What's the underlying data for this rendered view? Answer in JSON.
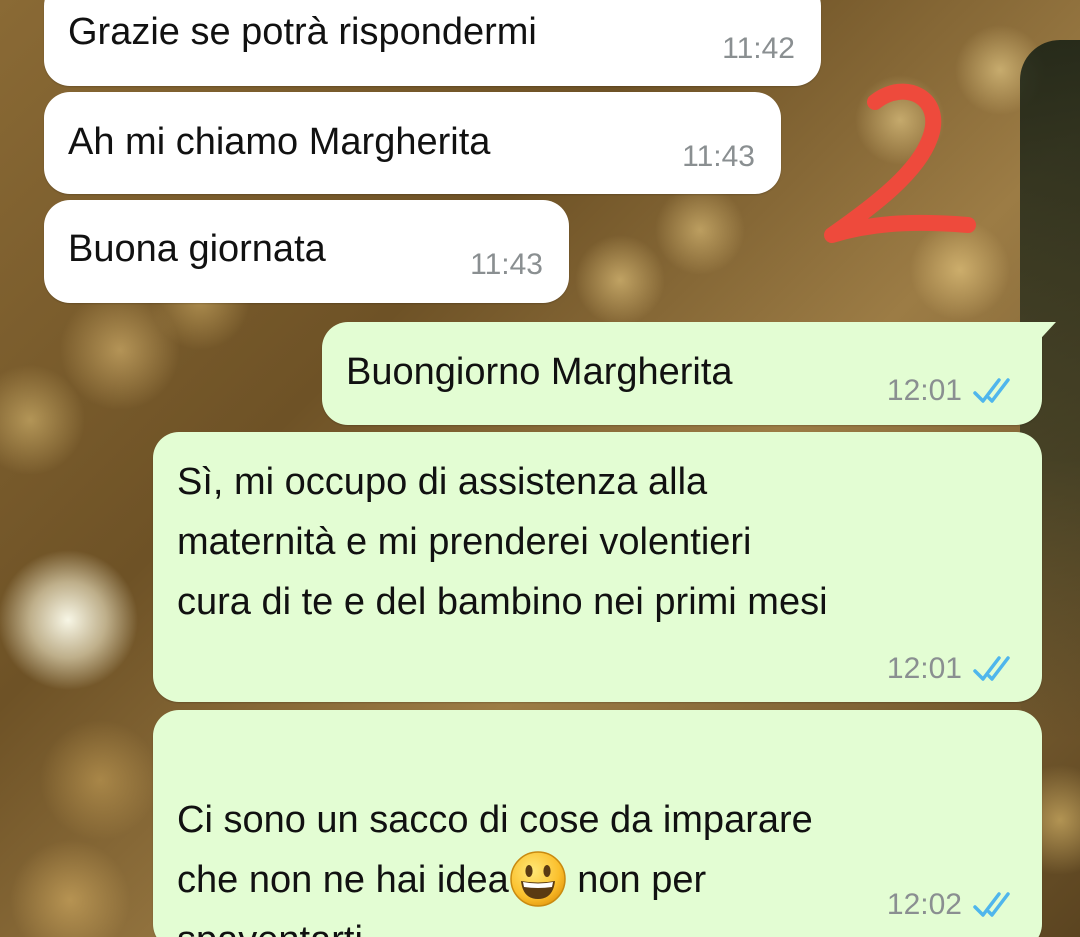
{
  "accent_colors": {
    "incoming_bubble": "#ffffff",
    "outgoing_bubble": "#e3fdd3",
    "read_ticks": "#4fb6ec",
    "timestamp": "#8a8f91",
    "annotation": "#ee4a3c"
  },
  "annotation_mark": {
    "icon": "handwritten-number-2",
    "label": "2"
  },
  "messages": [
    {
      "direction": "incoming",
      "text": "Grazie se potrà rispondermi",
      "time": "11:42"
    },
    {
      "direction": "incoming",
      "text": "Ah mi chiamo Margherita",
      "time": "11:43"
    },
    {
      "direction": "incoming",
      "text": "Buona giornata",
      "time": "11:43"
    },
    {
      "direction": "outgoing",
      "text": "Buongiorno Margherita",
      "time": "12:01",
      "status_icon": "double-check-read-icon"
    },
    {
      "direction": "outgoing",
      "text": "Sì, mi occupo di assistenza alla\nmaternità e mi prenderei volentieri\ncura di te e del bambino nei primi mesi",
      "time": "12:01",
      "status_icon": "double-check-read-icon"
    },
    {
      "direction": "outgoing",
      "text_before_emoji": "Ci sono un sacco di cose da imparare\nche non ne hai idea",
      "emoji": "grinning-face-emoji",
      "text_after_emoji": " non per\nspaventarti",
      "time": "12:02",
      "status_icon": "double-check-read-icon"
    }
  ]
}
